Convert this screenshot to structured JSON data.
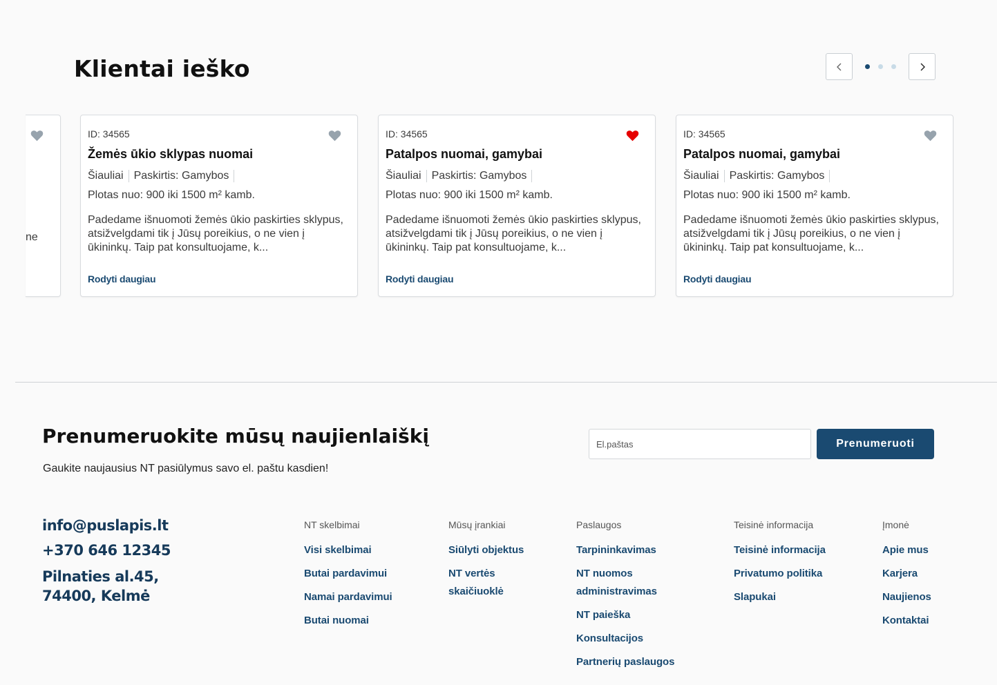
{
  "section": {
    "title": "Klientai ieško"
  },
  "carousel": {
    "prev_icon": "chevron-left-icon",
    "next_icon": "chevron-right-icon",
    "active_dot": 1,
    "dot_count": 3
  },
  "partial_card": {
    "text_fragment": "ne"
  },
  "cards": [
    {
      "id": "ID: 34565",
      "title": "Žemės ūkio sklypas nuomai",
      "city": "Šiauliai",
      "purpose": "Paskirtis: Gamybos",
      "area": "Plotas nuo: 900 iki 1500 m² kamb.",
      "desc": "Padedame išnuomoti žemės ūkio paskirties sklypus, atsižvelgdami tik į Jūsų poreikius, o ne vien į ūkininkų. Taip pat konsultuojame, k...",
      "more": "Rodyti daugiau",
      "favorite": false
    },
    {
      "id": "ID: 34565",
      "title": "Patalpos nuomai, gamybai",
      "city": "Šiauliai",
      "purpose": "Paskirtis: Gamybos",
      "area": "Plotas nuo: 900 iki 1500 m² kamb.",
      "desc": "Padedame išnuomoti žemės ūkio paskirties sklypus, atsižvelgdami tik į Jūsų poreikius, o ne vien į ūkininkų. Taip pat konsultuojame, k...",
      "more": "Rodyti daugiau",
      "favorite": true
    },
    {
      "id": "ID: 34565",
      "title": "Patalpos nuomai, gamybai",
      "city": "Šiauliai",
      "purpose": "Paskirtis: Gamybos",
      "area": "Plotas nuo: 900 iki 1500 m² kamb.",
      "desc": "Padedame išnuomoti žemės ūkio paskirties sklypus, atsižvelgdami tik į Jūsų poreikius, o ne vien į ūkininkų. Taip pat konsultuojame, k...",
      "more": "Rodyti daugiau",
      "favorite": false
    }
  ],
  "colors": {
    "accent": "#1a4a71",
    "heart_active": "#e60000",
    "heart_inactive": "#97a3ad"
  },
  "newsletter": {
    "title": "Prenumeruokite mūsų naujienlaiškį",
    "subtitle": "Gaukite naujausius NT pasiūlymus savo el. paštu kasdien!",
    "placeholder": "El.paštas",
    "button": "Prenumeruoti"
  },
  "contact": {
    "email": "info@puslapis.lt",
    "phone": "+370 646 12345",
    "address_line1": "Pilnaties al.45,",
    "address_line2": "74400, Kelmė"
  },
  "footer": {
    "columns": [
      {
        "heading": "NT skelbimai",
        "links": [
          "Visi skelbimai",
          "Butai pardavimui",
          "Namai pardavimui",
          "Butai nuomai"
        ]
      },
      {
        "heading": "Mūsų įrankiai",
        "links": [
          "Siūlyti objektus",
          "NT vertės skaičiuoklė"
        ]
      },
      {
        "heading": "Paslaugos",
        "links": [
          "Tarpininkavimas",
          "NT nuomos administravimas",
          "NT paieška",
          "Konsultacijos",
          "Partnerių paslaugos"
        ]
      },
      {
        "heading": "Teisinė informacija",
        "links": [
          "Teisinė informacija",
          "Privatumo politika",
          "Slapukai"
        ]
      },
      {
        "heading": "Įmonė",
        "links": [
          "Apie mus",
          "Karjera",
          "Naujienos",
          "Kontaktai"
        ]
      }
    ]
  }
}
